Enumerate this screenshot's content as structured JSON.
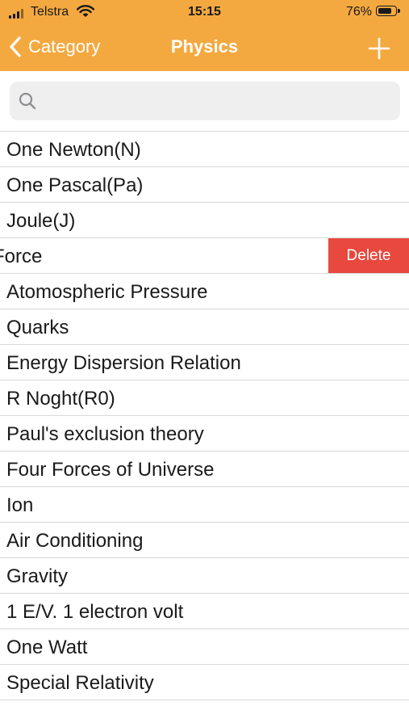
{
  "status_bar": {
    "carrier": "Telstra",
    "time": "15:15",
    "battery": "76%",
    "battery_level": 0.76
  },
  "nav": {
    "back_label": "Category",
    "title": "Physics",
    "add_icon": "plus-icon"
  },
  "search": {
    "placeholder": "",
    "value": "",
    "icon": "search-icon"
  },
  "list": {
    "items": [
      "One Newton(N)",
      "One Pascal(Pa)",
      "Joule(J)",
      "m-Force",
      "Atomospheric Pressure",
      "Quarks",
      "Energy Dispersion Relation",
      "R Noght(R0)",
      "Paul's exclusion theory",
      "Four Forces of Universe",
      "Ion",
      "Air Conditioning",
      "Gravity",
      "1 E/V. 1 electron volt",
      "One Watt",
      "Special Relativity"
    ],
    "swiped_index": 3,
    "delete_label": "Delete"
  },
  "colors": {
    "accent": "#f4a940",
    "delete": "#e8483e",
    "separator": "#d8d8d8",
    "search_bg": "#efefef"
  }
}
